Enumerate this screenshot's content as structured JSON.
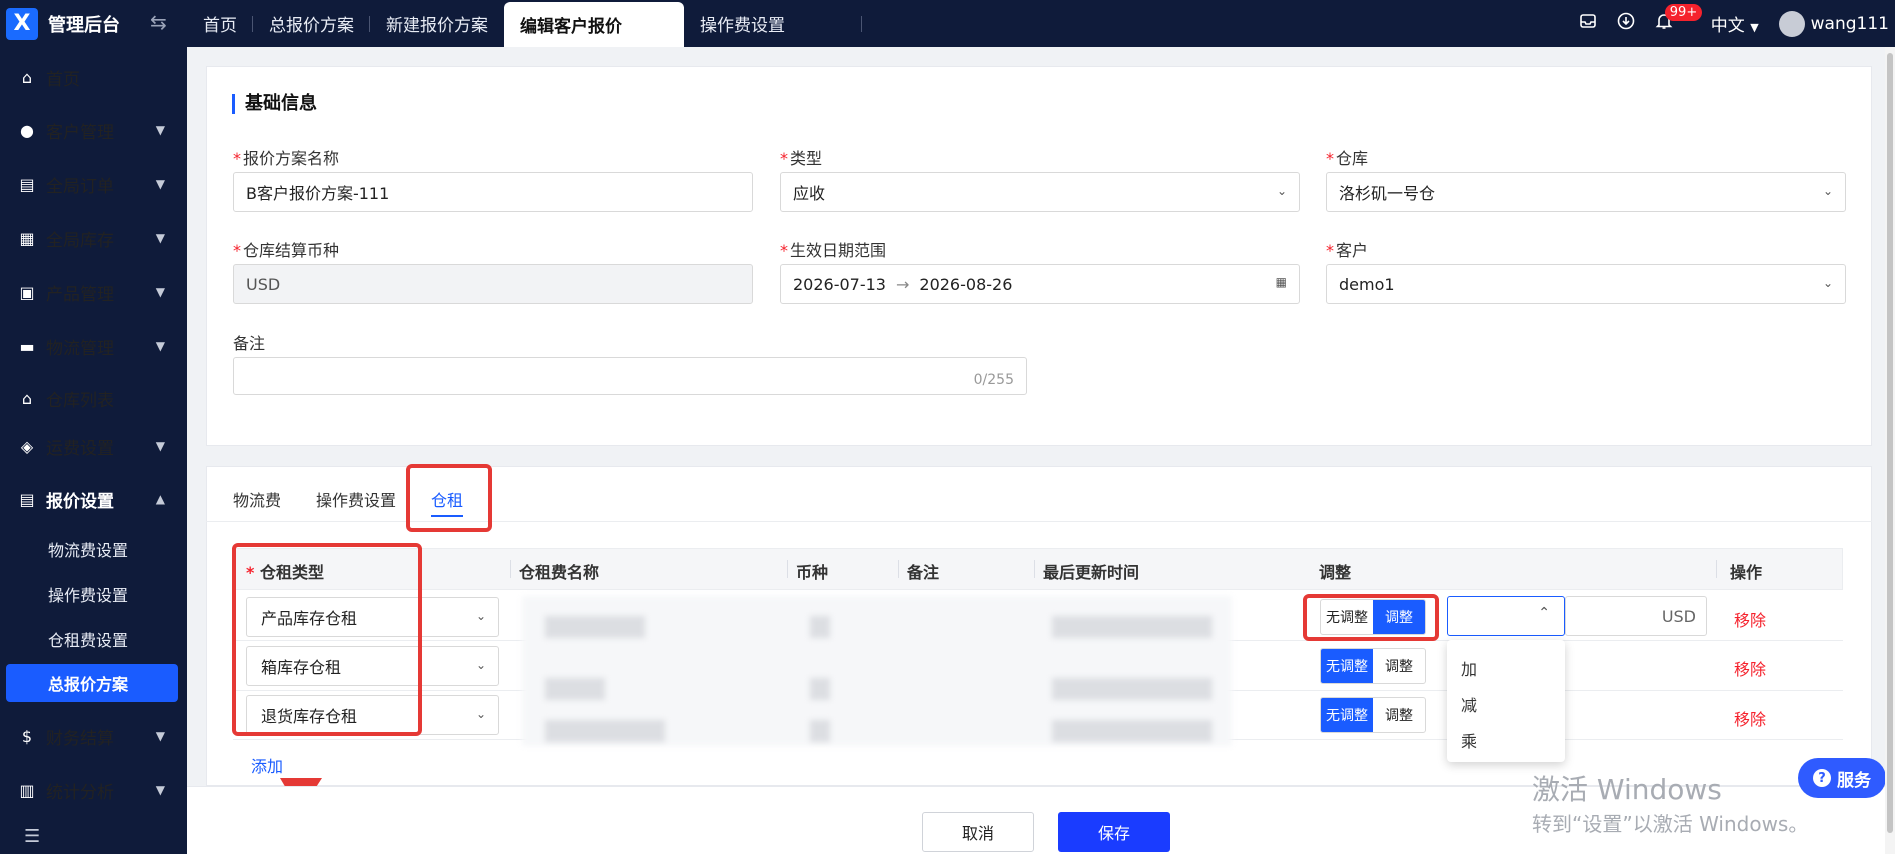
{
  "brand": {
    "title": "管理后台"
  },
  "tabs": [
    "首页",
    "总报价方案",
    "新建报价方案",
    "编辑客户报价",
    "操作费设置"
  ],
  "topbar": {
    "badge": "99+",
    "lang": "中文",
    "user": "wang111"
  },
  "sidebar": {
    "items": [
      "首页",
      "客户管理",
      "全局订单",
      "全局库存",
      "产品管理",
      "物流管理",
      "仓库列表",
      "运费设置",
      "报价设置",
      "财务结算",
      "统计分析"
    ],
    "sub_items": [
      "物流费设置",
      "操作费设置",
      "仓租费设置",
      "总报价方案"
    ]
  },
  "basic": {
    "title": "基础信息",
    "name_label": "报价方案名称",
    "name_value": "B客户报价方案-111",
    "type_label": "类型",
    "type_value": "应收",
    "warehouse_label": "仓库",
    "warehouse_value": "洛杉矶一号仓",
    "currency_label": "仓库结算币种",
    "currency_value": "USD",
    "date_label": "生效日期范围",
    "date_start": "2026-07-13",
    "date_end": "2026-08-26",
    "customer_label": "客户",
    "customer_value": "demo1",
    "remark_label": "备注",
    "remark_counter": "0/255"
  },
  "fee_tabs": [
    "物流费",
    "操作费设置",
    "仓租"
  ],
  "table": {
    "headers": [
      "仓租类型",
      "仓租费名称",
      "币种",
      "备注",
      "最后更新时间",
      "调整",
      "操作"
    ],
    "rows": [
      {
        "type": "产品库存仓租",
        "adjust_off": "无调整",
        "adjust_on": "调整",
        "remove": "移除"
      },
      {
        "type": "箱库存仓租",
        "adjust_off": "无调整",
        "adjust_on": "调整",
        "remove": "移除"
      },
      {
        "type": "退货库存仓租",
        "adjust_off": "无调整",
        "adjust_on": "调整",
        "remove": "移除"
      }
    ],
    "usd": "USD",
    "add": "添加",
    "menu": [
      "加",
      "减",
      "乘"
    ]
  },
  "footer": {
    "cancel": "取消",
    "save": "保存",
    "service": "服务"
  },
  "windows": {
    "line1": "激活 Windows",
    "line2": "转到“设置”以激活 Windows。"
  },
  "colors": {
    "primary": "#1a5cff",
    "sidebar": "#0f1b3a",
    "danger": "#f5222d",
    "highlight": "#e53935"
  }
}
